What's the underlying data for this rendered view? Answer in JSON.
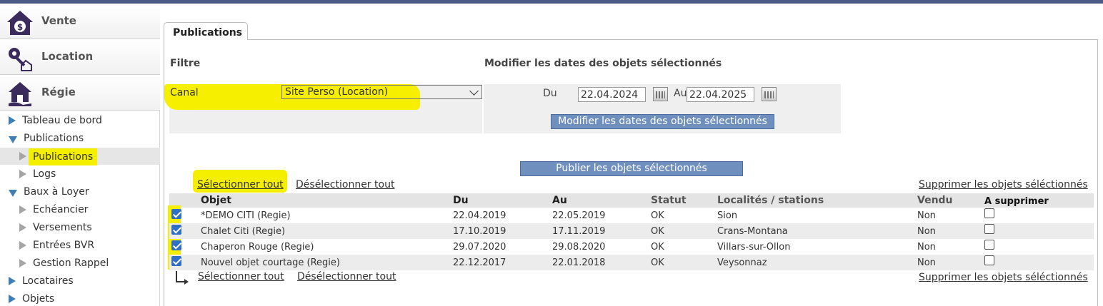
{
  "sidebar": {
    "modules": [
      {
        "label": "Vente",
        "icon": "house-dollar-icon"
      },
      {
        "label": "Location",
        "icon": "key-house-icon"
      },
      {
        "label": "Régie",
        "icon": "house-hand-icon"
      }
    ],
    "tree": [
      {
        "label": "Tableau de bord"
      },
      {
        "label": "Publications"
      },
      {
        "label": "Publications"
      },
      {
        "label": "Logs"
      },
      {
        "label": "Baux à Loyer"
      },
      {
        "label": "Echéancier"
      },
      {
        "label": "Versements"
      },
      {
        "label": "Entrées BVR"
      },
      {
        "label": "Gestion Rappel"
      },
      {
        "label": "Locataires"
      },
      {
        "label": "Objets"
      }
    ]
  },
  "tab": {
    "label": "Publications"
  },
  "filter": {
    "title": "Filtre",
    "canal_label": "Canal",
    "canal_value": "Site Perso (Location)"
  },
  "dates": {
    "title": "Modifier les dates des objets sélectionnés",
    "from_label": "Du",
    "from_value": "22.04.2024",
    "to_label": "Au",
    "to_value": "22.04.2025",
    "button": "Modifier les dates des objets sélectionnés"
  },
  "publish_button": "Publier les objets sélectionnés",
  "actions": {
    "select_all": "Sélectionner tout",
    "deselect_all": "Désélectionner tout",
    "delete_selected": "Supprimer  les objets séléctionnés"
  },
  "table": {
    "columns": [
      "Objet",
      "Du",
      "Au",
      "Statut",
      "Localités / stations",
      "Vendu",
      "A supprimer"
    ],
    "rows": [
      {
        "objet": "*DEMO CITI (Regie)",
        "du": "22.04.2019",
        "au": "22.05.2019",
        "statut": "OK",
        "localite": "Sion",
        "vendu": "Non",
        "selected": true,
        "to_delete": false
      },
      {
        "objet": "Chalet Citi (Regie)",
        "du": "17.10.2019",
        "au": "17.11.2019",
        "statut": "OK",
        "localite": "Crans-Montana",
        "vendu": "Non",
        "selected": true,
        "to_delete": false
      },
      {
        "objet": "Chaperon Rouge (Regie)",
        "du": "29.07.2020",
        "au": "29.08.2020",
        "statut": "OK",
        "localite": "Villars-sur-Ollon",
        "vendu": "Non",
        "selected": true,
        "to_delete": false
      },
      {
        "objet": "Nouvel objet courtage (Regie)",
        "du": "22.12.2017",
        "au": "22.01.2018",
        "statut": "OK",
        "localite": "Veysonnaz",
        "vendu": "Non",
        "selected": true,
        "to_delete": false
      }
    ]
  },
  "colors": {
    "accent": "#6f8fbf",
    "tree_arrow": "#3f7fb8",
    "highlight": "#f4ef00",
    "top_bar": "#4a5a84"
  }
}
